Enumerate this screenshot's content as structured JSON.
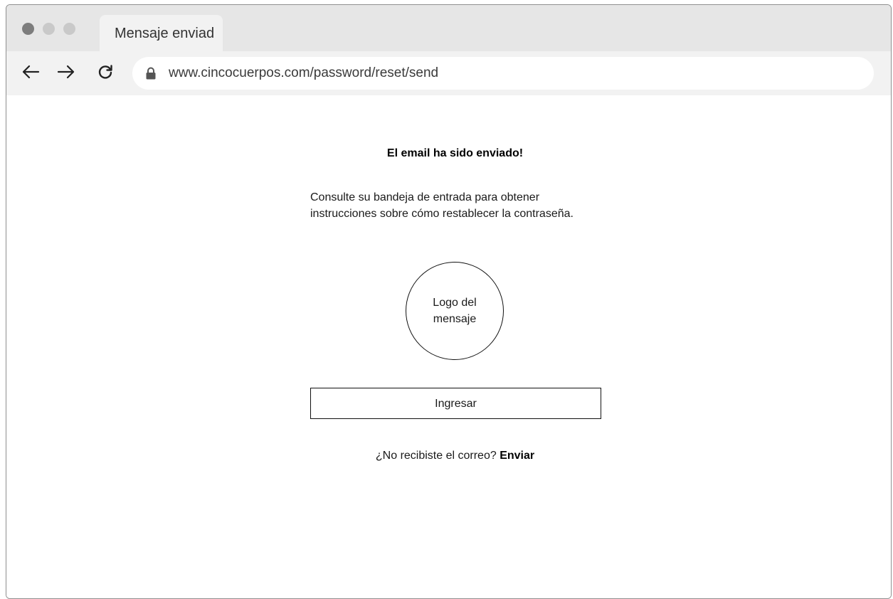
{
  "browser": {
    "tab_title": "Mensaje enviad",
    "url": "www.cincocuerpos.com/password/reset/send",
    "icons": {
      "back": "arrow-left-icon",
      "forward": "arrow-right-icon",
      "reload": "reload-icon",
      "secure": "lock-icon"
    },
    "window_dots": [
      "close",
      "minimize",
      "maximize"
    ]
  },
  "page": {
    "headline": "El email ha sido enviado!",
    "description_lines": [
      "Consulte su bandeja de entrada para obtener",
      "instrucciones sobre cómo restablecer la contraseña."
    ],
    "logo_lines": [
      "Logo del",
      "mensaje"
    ],
    "login_button": "Ingresar",
    "resend_prompt": "¿No recibiste el correo?",
    "resend_link": "Enviar"
  },
  "colors": {
    "chrome_tabbar": "#e6e6e6",
    "chrome_toolbar": "#f2f2f2",
    "page_background": "#ffffff",
    "text": "#000000",
    "border": "#111111"
  }
}
